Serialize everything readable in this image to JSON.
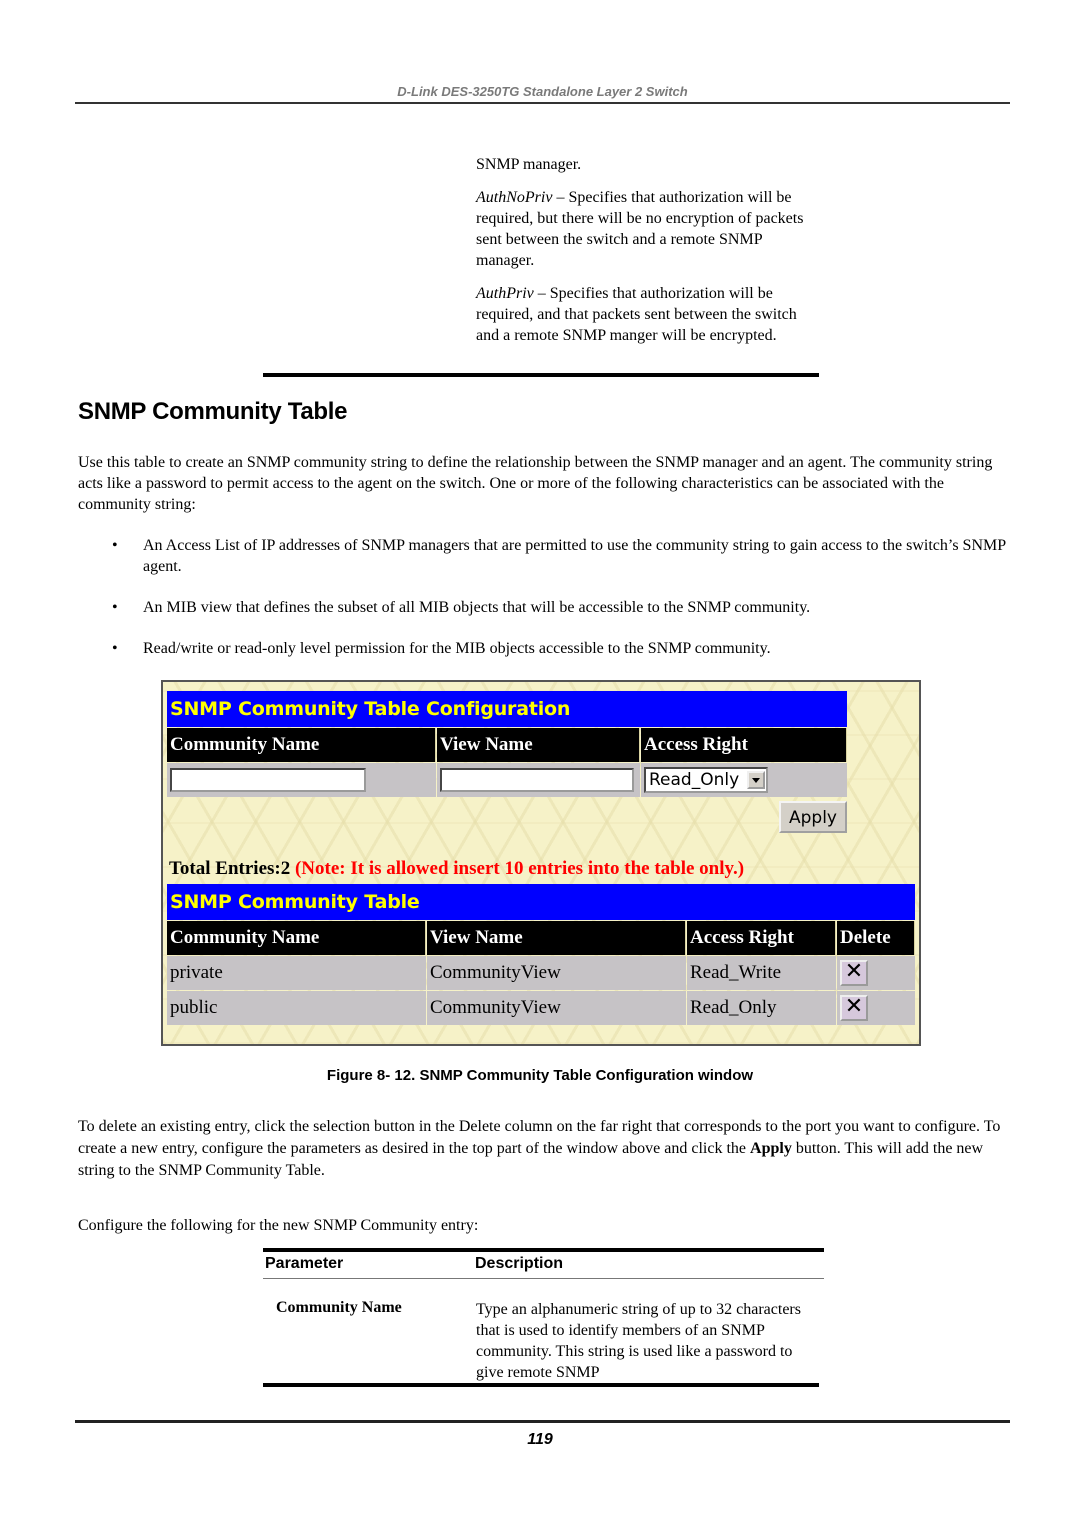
{
  "header": {
    "running_title": "D-Link DES-3250TG Standalone Layer 2 Switch"
  },
  "continued": {
    "line0": "SNMP manager.",
    "authnopriv_term": "AuthNoPriv",
    "authnopriv_text": " – Specifies that authorization will be required, but there will be no encryption of packets sent between the switch and a remote SNMP manager.",
    "authpriv_term": "AuthPriv",
    "authpriv_text": " – Specifies that authorization will be required, and that packets sent between the switch and a remote SNMP manger will be encrypted."
  },
  "section": {
    "title": "SNMP Community Table",
    "intro": "Use this table to create an SNMP community string to define the relationship between the SNMP manager and an agent. The community string acts like a password to permit access to the agent on the switch. One or more of the following characteristics can be associated with the community string:",
    "bullet_glyph": "•",
    "bullets": [
      "An Access List of IP addresses of SNMP managers that are permitted to use the community string to gain access to the switch’s SNMP agent.",
      "An MIB view that defines the subset of all MIB objects that will be accessible to the SNMP community.",
      "Read/write or read-only level permission for the MIB objects accessible to the SNMP community."
    ]
  },
  "window": {
    "config_title": "SNMP Community Table Configuration",
    "config_headers": [
      "Community Name",
      "View Name",
      "Access Right"
    ],
    "community_name_value": "",
    "view_name_value": "",
    "access_right_selected": "Read_Only",
    "apply_label": "Apply",
    "total_entries": "Total Entries:2",
    "note": "(Note: It is allowed insert 10 entries into the table only.)",
    "table_title": "SNMP Community Table",
    "table_headers": [
      "Community Name",
      "View Name",
      "Access Right",
      "Delete"
    ],
    "rows": [
      {
        "community": "private",
        "view": "CommunityView",
        "access": "Read_Write"
      },
      {
        "community": "public",
        "view": "CommunityView",
        "access": "Read_Only"
      }
    ],
    "delete_glyph": "✕",
    "colors": {
      "title_bar": "#0000ff",
      "title_text": "#ffff00",
      "header_bg": "#000000",
      "cell_bg": "#c6c3c6",
      "note": "#ff0000"
    }
  },
  "figure_caption": "Figure 8- 12. SNMP Community Table Configuration window",
  "para_delete": {
    "text1": "To delete an existing entry, click the selection button in the Delete column on the far right that corresponds to the port you want to configure. To create a new entry, configure the parameters as desired in the top part of the window above and click the ",
    "bold": "Apply",
    "text2": " button. This will add the new string to the SNMP Community Table."
  },
  "para_configure": "Configure the following for the new SNMP Community entry:",
  "param_table": {
    "headers": [
      "Parameter",
      "Description"
    ],
    "rows": [
      {
        "parameter": "Community Name",
        "description": "Type an alphanumeric string of up to 32 characters that is used to identify members of an SNMP community.  This string is used like a password to give remote SNMP"
      }
    ]
  },
  "footer": {
    "page_number": "119"
  }
}
